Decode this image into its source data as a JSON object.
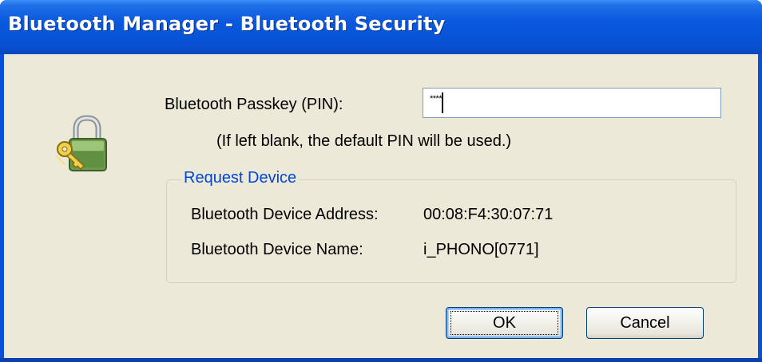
{
  "window": {
    "title": "Bluetooth Manager - Bluetooth Security"
  },
  "icons": {
    "security": "lock-and-key-icon"
  },
  "passkey": {
    "label": "Bluetooth Passkey (PIN):",
    "value": "****",
    "hint": "(If left blank, the default PIN will be used.)"
  },
  "request_device": {
    "group_title": "Request Device",
    "address_label": "Bluetooth Device Address:",
    "address_value": "00:08:F4:30:07:71",
    "name_label": "Bluetooth Device Name:",
    "name_value": "i_PHONO[0771]"
  },
  "buttons": {
    "ok": "OK",
    "cancel": "Cancel"
  },
  "colors": {
    "titlebar": "#0754d6",
    "dialog_background": "#ece9d8",
    "group_title": "#0046d5"
  }
}
